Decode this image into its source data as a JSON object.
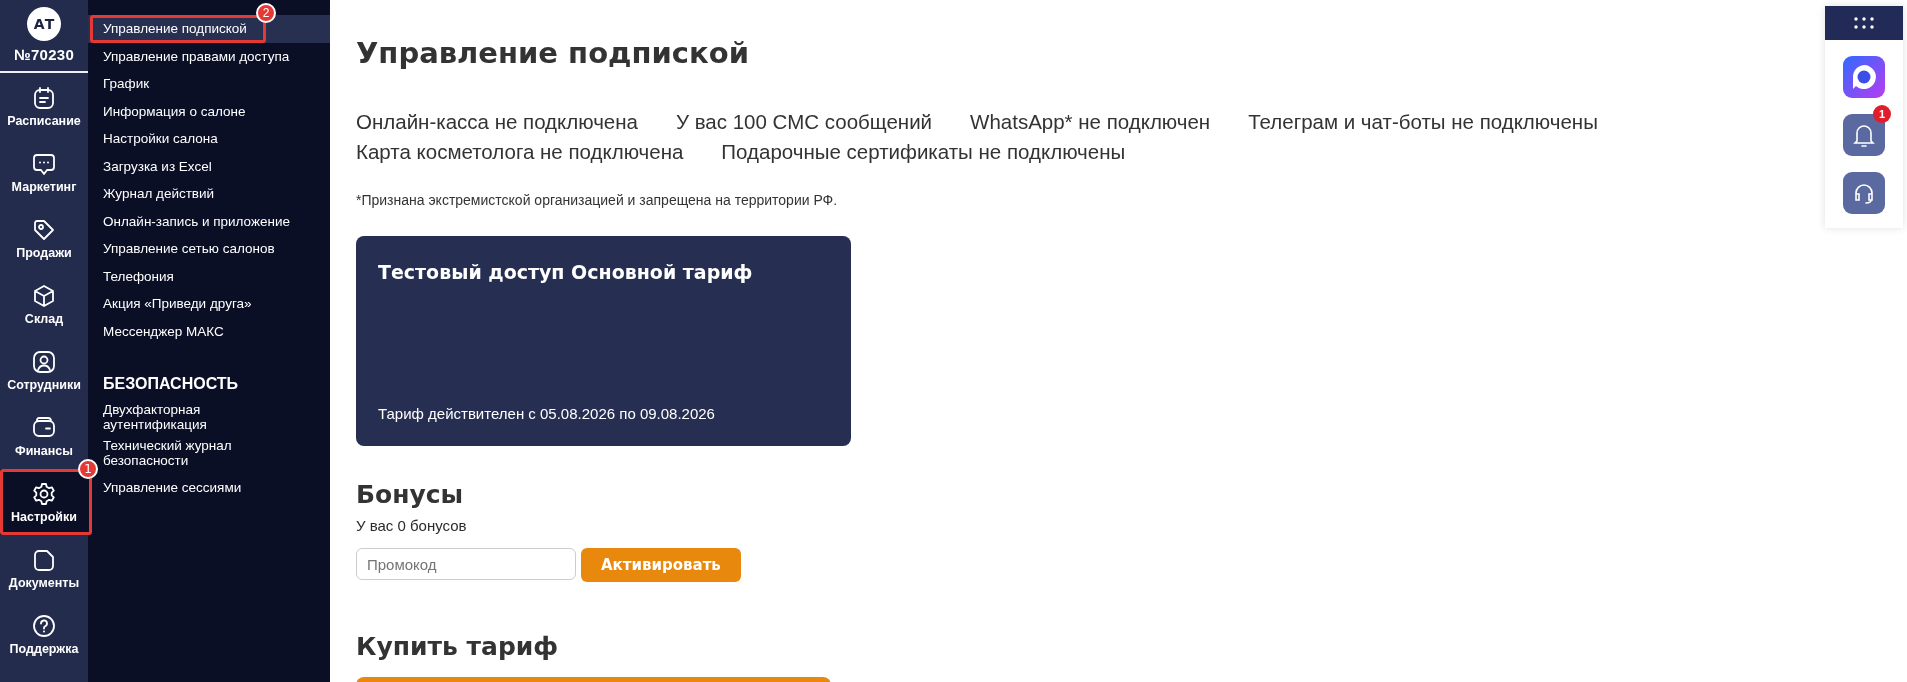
{
  "account": {
    "initials": "АТ",
    "number": "№70230"
  },
  "rail": [
    {
      "label": "Расписание",
      "selected": false
    },
    {
      "label": "Маркетинг",
      "selected": false
    },
    {
      "label": "Продажи",
      "selected": false
    },
    {
      "label": "Склад",
      "selected": false
    },
    {
      "label": "Сотрудники",
      "selected": false
    },
    {
      "label": "Финансы",
      "selected": false
    },
    {
      "label": "Настройки",
      "selected": true,
      "callout": "1"
    },
    {
      "label": "Документы",
      "selected": false
    },
    {
      "label": "Поддержка",
      "selected": false
    }
  ],
  "submenu": [
    {
      "label": "Управление подпиской",
      "selected": true,
      "callout": "2"
    },
    {
      "label": "Управление правами доступа",
      "selected": false
    },
    {
      "label": "График",
      "selected": false
    },
    {
      "label": "Информация о салоне",
      "selected": false
    },
    {
      "label": "Настройки салона",
      "selected": false
    },
    {
      "label": "Загрузка из Excel",
      "selected": false
    },
    {
      "label": "Журнал действий",
      "selected": false
    },
    {
      "label": "Онлайн-запись и приложение",
      "selected": false
    },
    {
      "label": "Управление сетью салонов",
      "selected": false
    },
    {
      "label": "Телефония",
      "selected": false
    },
    {
      "label": "Акция «Приведи друга»",
      "selected": false
    },
    {
      "label": "Мессенджер МАКС",
      "selected": false
    }
  ],
  "security": {
    "title": "БЕЗОПАСНОСТЬ",
    "items": [
      {
        "label": "Двухфакторная аутентификация",
        "selected": false
      },
      {
        "label": "Технический журнал безопасности",
        "selected": false
      },
      {
        "label": "Управление сессиями",
        "selected": false
      }
    ]
  },
  "page": {
    "title": "Управление подпиской",
    "statuses": [
      "Онлайн-касса не подключена",
      "У вас 100 СМС сообщений",
      "WhatsApp* не подключен",
      "Телеграм и чат-боты не подключены",
      "Карта косметолога не подключена",
      "Подарочные сертификаты не подключены"
    ],
    "footnote": "*Признана экстремистской организацией и запрещена на территории РФ.",
    "tariff_card": {
      "title": "Тестовый доступ Основной тариф",
      "validity": "Тариф действителен с 05.08.2026 по 09.08.2026"
    },
    "bonuses": {
      "title": "Бонусы",
      "balance": "У вас 0 бонусов",
      "promo_placeholder": "Промокод",
      "activate_button": "Активировать"
    },
    "buy": {
      "title": "Купить тариф"
    }
  },
  "dock": [
    {
      "kind": "app"
    },
    {
      "kind": "bell",
      "badge": "1"
    },
    {
      "kind": "support"
    }
  ]
}
